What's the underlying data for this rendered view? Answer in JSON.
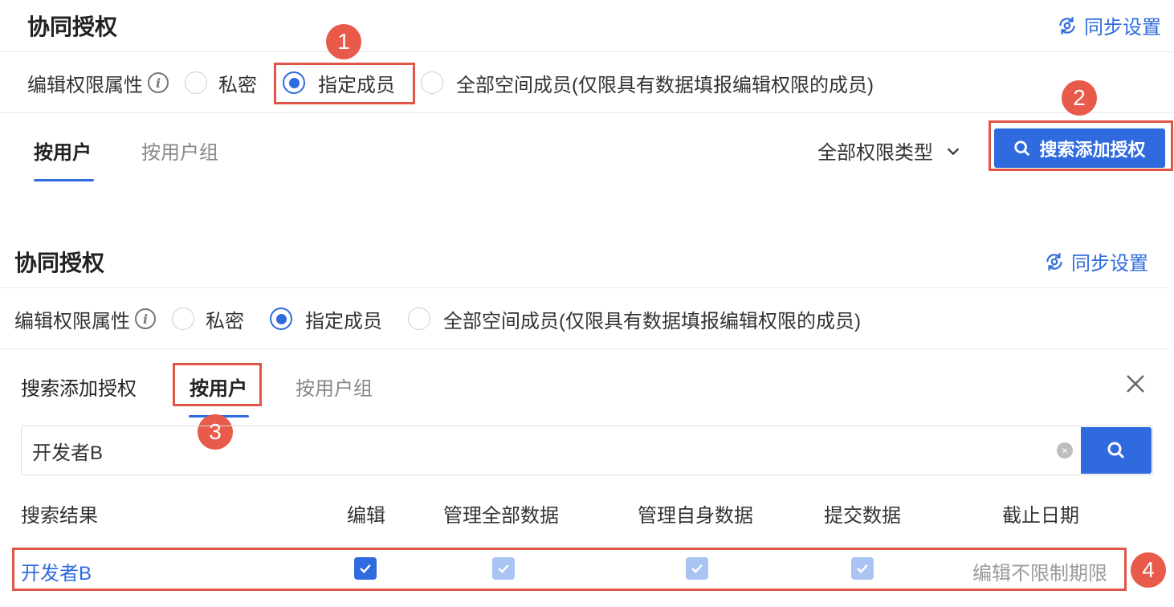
{
  "top": {
    "title": "协同授权",
    "sync_label": "同步设置",
    "perm_label": "编辑权限属性",
    "radio_options": [
      "私密",
      "指定成员",
      "全部空间成员(仅限具有数据填报编辑权限的成员)"
    ],
    "selected_option": "指定成员",
    "tabs": [
      "按用户",
      "按用户组"
    ],
    "active_tab": "按用户",
    "filter_label": "全部权限类型",
    "search_add_button": "搜索添加授权"
  },
  "bottom": {
    "title": "协同授权",
    "sync_label": "同步设置",
    "perm_label": "编辑权限属性",
    "radio_options": [
      "私密",
      "指定成员",
      "全部空间成员(仅限具有数据填报编辑权限的成员)"
    ],
    "selected_option": "指定成员",
    "panel_title": "搜索添加授权",
    "tabs": [
      "按用户",
      "按用户组"
    ],
    "active_tab": "按用户",
    "search_value": "开发者B",
    "columns": [
      "搜索结果",
      "编辑",
      "管理全部数据",
      "管理自身数据",
      "提交数据",
      "截止日期"
    ],
    "rows": [
      {
        "name": "开发者B",
        "edit": true,
        "manage_all": true,
        "manage_self": true,
        "submit": true,
        "deadline": "编辑不限制期限"
      }
    ]
  },
  "annotations": [
    "1",
    "2",
    "3",
    "4"
  ],
  "colors": {
    "accent": "#2f6bde",
    "annotation_red": "#e05547",
    "checkbox_disabled": "#a9c4f2"
  }
}
